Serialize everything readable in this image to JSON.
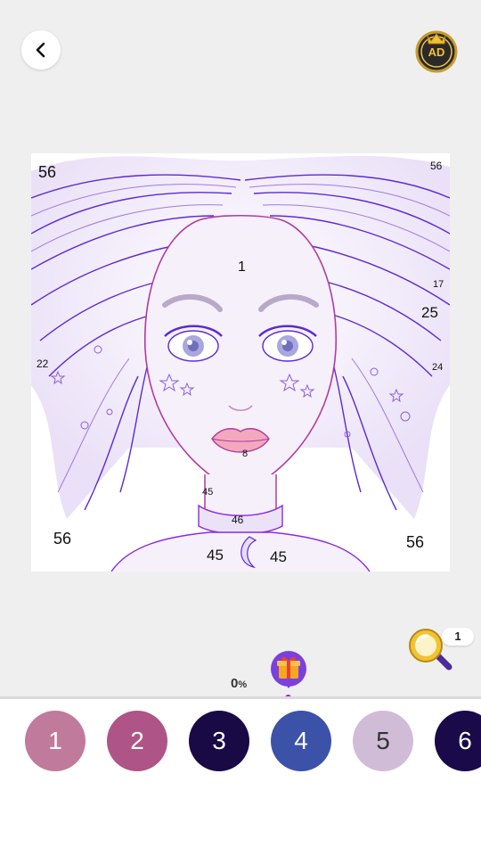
{
  "header": {
    "back_icon": "chevron-left-icon",
    "ad_badge": "AD"
  },
  "canvas": {
    "subject": "girl portrait line-art",
    "numbers": [
      "56",
      "56",
      "1",
      "17",
      "25",
      "22",
      "24",
      "8",
      "45",
      "46",
      "45",
      "45",
      "56",
      "56"
    ]
  },
  "hint": {
    "count": "1",
    "icon": "magnifier-icon"
  },
  "progress": {
    "value": "0",
    "unit": "%",
    "gift_icon": "gift-icon"
  },
  "palette": {
    "swatches": [
      {
        "label": "1",
        "color": "#c07a9c"
      },
      {
        "label": "2",
        "color": "#ae5487"
      },
      {
        "label": "3",
        "color": "#190a45"
      },
      {
        "label": "4",
        "color": "#3c52a8"
      },
      {
        "label": "5",
        "color": "#d1bcd8"
      },
      {
        "label": "6",
        "color": "#1a0a4a"
      }
    ]
  },
  "colors": {
    "line_primary": "#5a2ad6",
    "line_secondary": "#b03aa3",
    "tint": "#e9def7"
  }
}
